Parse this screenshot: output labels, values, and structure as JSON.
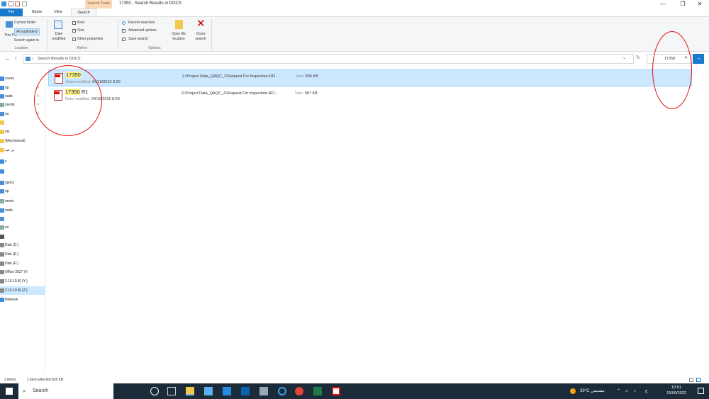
{
  "window": {
    "contextual_tab": "Search Tools",
    "title": "17350 - Search Results in DOCS",
    "controls": [
      "—",
      "❐",
      "✕"
    ]
  },
  "tabs": {
    "file": "File",
    "share": "Share",
    "view": "View",
    "search": "Search"
  },
  "ribbon": {
    "location": {
      "this_pc": "This PC",
      "current_folder": "Current folder",
      "all_subfolders": "All subfolders",
      "search_again": "Search again in",
      "label": "Location"
    },
    "refine": {
      "date_modified": "Date modified",
      "kind": "Kind",
      "size": "Size",
      "other_properties": "Other properties",
      "label": "Refine"
    },
    "options": {
      "recent_searches": "Recent searches",
      "advanced_options": "Advanced options",
      "save_search": "Save search",
      "open_file_location": "Open file location",
      "close_search": "Close search",
      "label": "Options"
    }
  },
  "address": {
    "path": "Search Results in DOCS",
    "search_value": "17350"
  },
  "navpane": [
    {
      "label": "ccess",
      "selected": false
    },
    {
      "label": "op",
      "selected": false
    },
    {
      "label": "oads",
      "selected": false
    },
    {
      "label": "ments",
      "selected": false
    },
    {
      "label": "es",
      "selected": false
    },
    {
      "label": "",
      "selected": false
    },
    {
      "label": "sts",
      "selected": false
    },
    {
      "label": "(Mechanical)",
      "selected": false
    },
    {
      "label": "ير عيد",
      "selected": false
    },
    {
      "label": "s",
      "selected": false
    },
    {
      "label": "",
      "selected": false
    },
    {
      "label": "ojects",
      "selected": false
    },
    {
      "label": "op",
      "selected": false
    },
    {
      "label": "nents",
      "selected": false
    },
    {
      "label": "oads",
      "selected": false
    },
    {
      "label": "",
      "selected": false
    },
    {
      "label": "es",
      "selected": false
    },
    {
      "label": "",
      "selected": false
    },
    {
      "label": "Disk (C:)",
      "selected": false
    },
    {
      "label": "Disk (E:)",
      "selected": false
    },
    {
      "label": "Disk (F:)",
      "selected": false
    },
    {
      "label": "Office 2027 (Y:",
      "selected": false
    },
    {
      "label": "2.16.10.8) (Y:)",
      "selected": false
    },
    {
      "label": "2.16.10.8) (Z:)",
      "selected": true
    },
    {
      "label": "Network",
      "selected": false
    }
  ],
  "files": [
    {
      "name": "17350",
      "name_rest": "",
      "date_label": "Date modified:",
      "date": "24/10/2015 8:20",
      "path": "Z:\\Project Data_QAQC_Z\\Request For Inspection-RFI...",
      "size_label": "Size:",
      "size": "835 KB",
      "selected": true
    },
    {
      "name": "17350",
      "name_rest": " R1",
      "date_label": "Date modified:",
      "date": "24/10/2015 8:20",
      "path": "Z:\\Project Data_QAQC_Z\\Request For Inspection-RFI...",
      "size_label": "Size:",
      "size": "987 KB",
      "selected": false
    }
  ],
  "status": {
    "items": "2 items",
    "selected": "1 item selected  835 KB"
  },
  "taskbar": {
    "search_placeholder": "Search",
    "weather": "39°C  مشمس",
    "time": "10:51",
    "date": "15/09/2022",
    "lang": "ع"
  },
  "colors": {
    "accent": "#1979ca",
    "selection": "#cce8ff",
    "annotation": "#e01010",
    "highlight": "#fff48a"
  }
}
